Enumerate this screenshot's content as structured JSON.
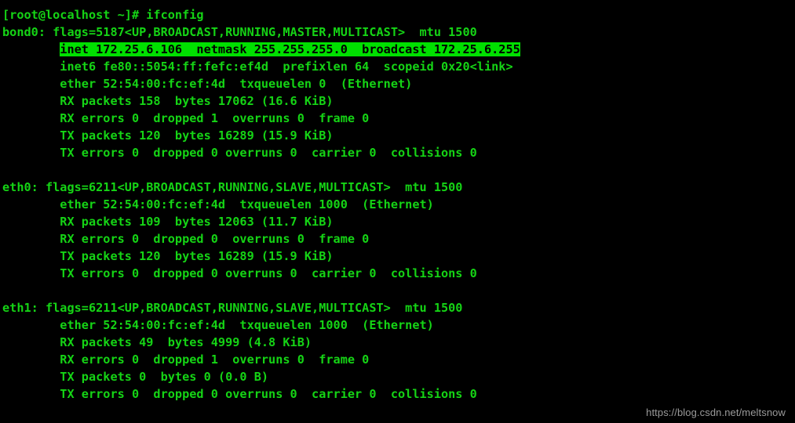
{
  "terminal": {
    "background_color": "#000000",
    "text_color": "#15d415",
    "highlight_background_color": "#00e000",
    "highlight_text_color": "#000000",
    "prompt": "[root@localhost ~]#",
    "command": "ifconfig",
    "prompt_line": "[root@localhost ~]# ifconfig",
    "lines": [
      {
        "text": "[root@localhost ~]# ifconfig",
        "highlight": false
      },
      {
        "text": "bond0: flags=5187<UP,BROADCAST,RUNNING,MASTER,MULTICAST>  mtu 1500",
        "highlight": false
      },
      {
        "text": "        inet 172.25.6.106  netmask 255.255.255.0  broadcast 172.25.6.255",
        "highlight": true,
        "highlight_start": 8
      },
      {
        "text": "        inet6 fe80::5054:ff:fefc:ef4d  prefixlen 64  scopeid 0x20<link>",
        "highlight": false
      },
      {
        "text": "        ether 52:54:00:fc:ef:4d  txqueuelen 0  (Ethernet)",
        "highlight": false
      },
      {
        "text": "        RX packets 158  bytes 17062 (16.6 KiB)",
        "highlight": false
      },
      {
        "text": "        RX errors 0  dropped 1  overruns 0  frame 0",
        "highlight": false
      },
      {
        "text": "        TX packets 120  bytes 16289 (15.9 KiB)",
        "highlight": false
      },
      {
        "text": "        TX errors 0  dropped 0 overruns 0  carrier 0  collisions 0",
        "highlight": false
      },
      {
        "text": "",
        "highlight": false
      },
      {
        "text": "eth0: flags=6211<UP,BROADCAST,RUNNING,SLAVE,MULTICAST>  mtu 1500",
        "highlight": false
      },
      {
        "text": "        ether 52:54:00:fc:ef:4d  txqueuelen 1000  (Ethernet)",
        "highlight": false
      },
      {
        "text": "        RX packets 109  bytes 12063 (11.7 KiB)",
        "highlight": false
      },
      {
        "text": "        RX errors 0  dropped 0  overruns 0  frame 0",
        "highlight": false
      },
      {
        "text": "        TX packets 120  bytes 16289 (15.9 KiB)",
        "highlight": false
      },
      {
        "text": "        TX errors 0  dropped 0 overruns 0  carrier 0  collisions 0",
        "highlight": false
      },
      {
        "text": "",
        "highlight": false
      },
      {
        "text": "eth1: flags=6211<UP,BROADCAST,RUNNING,SLAVE,MULTICAST>  mtu 1500",
        "highlight": false
      },
      {
        "text": "        ether 52:54:00:fc:ef:4d  txqueuelen 1000  (Ethernet)",
        "highlight": false
      },
      {
        "text": "        RX packets 49  bytes 4999 (4.8 KiB)",
        "highlight": false
      },
      {
        "text": "        RX errors 0  dropped 1  overruns 0  frame 0",
        "highlight": false
      },
      {
        "text": "        TX packets 0  bytes 0 (0.0 B)",
        "highlight": false
      },
      {
        "text": "        TX errors 0  dropped 0 overruns 0  carrier 0  collisions 0",
        "highlight": false
      }
    ],
    "interfaces": [
      {
        "name": "bond0",
        "flags": "5187<UP,BROADCAST,RUNNING,MASTER,MULTICAST>",
        "mtu": "1500",
        "inet": "172.25.6.106",
        "netmask": "255.255.255.0",
        "broadcast": "172.25.6.255",
        "inet6": "fe80::5054:ff:fefc:ef4d",
        "prefixlen": "64",
        "scopeid": "0x20<link>",
        "ether": "52:54:00:fc:ef:4d",
        "txqueuelen": "0",
        "link_type": "(Ethernet)",
        "rx_packets": "158",
        "rx_bytes": "17062",
        "rx_human": "(16.6 KiB)",
        "rx_errors": "0",
        "rx_dropped": "1",
        "rx_overruns": "0",
        "rx_frame": "0",
        "tx_packets": "120",
        "tx_bytes": "16289",
        "tx_human": "(15.9 KiB)",
        "tx_errors": "0",
        "tx_dropped": "0",
        "tx_overruns": "0",
        "tx_carrier": "0",
        "tx_collisions": "0"
      },
      {
        "name": "eth0",
        "flags": "6211<UP,BROADCAST,RUNNING,SLAVE,MULTICAST>",
        "mtu": "1500",
        "ether": "52:54:00:fc:ef:4d",
        "txqueuelen": "1000",
        "link_type": "(Ethernet)",
        "rx_packets": "109",
        "rx_bytes": "12063",
        "rx_human": "(11.7 KiB)",
        "rx_errors": "0",
        "rx_dropped": "0",
        "rx_overruns": "0",
        "rx_frame": "0",
        "tx_packets": "120",
        "tx_bytes": "16289",
        "tx_human": "(15.9 KiB)",
        "tx_errors": "0",
        "tx_dropped": "0",
        "tx_overruns": "0",
        "tx_carrier": "0",
        "tx_collisions": "0"
      },
      {
        "name": "eth1",
        "flags": "6211<UP,BROADCAST,RUNNING,SLAVE,MULTICAST>",
        "mtu": "1500",
        "ether": "52:54:00:fc:ef:4d",
        "txqueuelen": "1000",
        "link_type": "(Ethernet)",
        "rx_packets": "49",
        "rx_bytes": "4999",
        "rx_human": "(4.8 KiB)",
        "rx_errors": "0",
        "rx_dropped": "1",
        "rx_overruns": "0",
        "rx_frame": "0",
        "tx_packets": "0",
        "tx_bytes": "0",
        "tx_human": "(0.0 B)",
        "tx_errors": "0",
        "tx_dropped": "0",
        "tx_overruns": "0",
        "tx_carrier": "0",
        "tx_collisions": "0"
      }
    ]
  },
  "watermark": {
    "text": "https://blog.csdn.net/meltsnow",
    "color": "#9a9a9a"
  }
}
